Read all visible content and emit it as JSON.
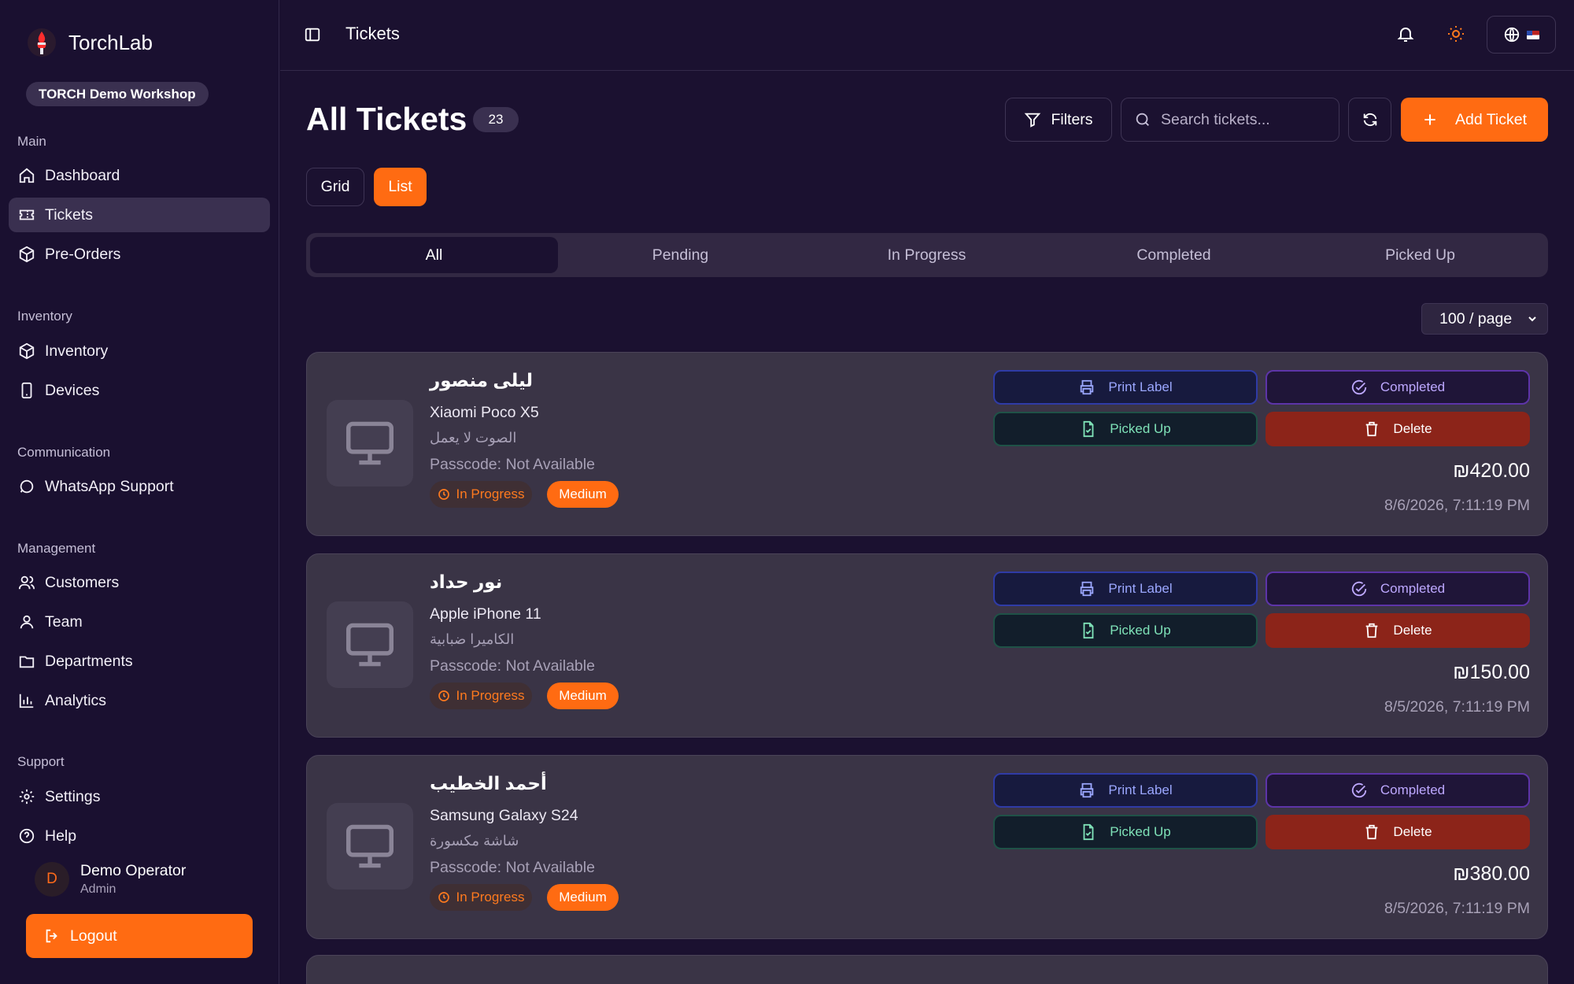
{
  "app": {
    "name": "TorchLab",
    "workspace": "TORCH Demo Workshop"
  },
  "sidebar": {
    "sections": [
      {
        "title": "Main",
        "items": [
          "Dashboard",
          "Tickets",
          "Pre-Orders"
        ]
      },
      {
        "title": "Inventory",
        "items": [
          "Inventory",
          "Devices"
        ]
      },
      {
        "title": "Communication",
        "items": [
          "WhatsApp Support"
        ]
      },
      {
        "title": "Management",
        "items": [
          "Customers",
          "Team",
          "Departments",
          "Analytics"
        ]
      },
      {
        "title": "Support",
        "items": [
          "Settings",
          "Help"
        ]
      }
    ],
    "active_item": "Tickets",
    "icons": [
      "home-icon",
      "ticket-icon",
      "package-icon",
      "package-icon",
      "smartphone-icon",
      "chat-icon",
      "users-icon",
      "user-icon",
      "folder-icon",
      "bar-chart-icon",
      "gear-icon",
      "help-icon"
    ]
  },
  "user": {
    "initial": "D",
    "name": "Demo Operator",
    "role": "Admin"
  },
  "logout_label": "Logout",
  "header": {
    "breadcrumb": "Tickets"
  },
  "page": {
    "title": "All Tickets",
    "count": "23",
    "filters_label": "Filters",
    "search_placeholder": "Search tickets...",
    "add_label": "Add Ticket",
    "views": {
      "grid": "Grid",
      "list": "List",
      "active": "List"
    },
    "tabs": [
      "All",
      "Pending",
      "In Progress",
      "Completed",
      "Picked Up"
    ],
    "active_tab": "All",
    "per_page": "100 / page"
  },
  "actions": {
    "print": "Print Label",
    "completed": "Completed",
    "picked": "Picked Up",
    "delete": "Delete"
  },
  "tickets": [
    {
      "customer": "ليلى منصور",
      "device": "Xiaomi Poco X5",
      "issue": "الصوت لا يعمل",
      "passcode": "Passcode: Not Available",
      "status": "In Progress",
      "priority": "Medium",
      "price": "₪420.00",
      "date": "8/6/2026, 7:11:19 PM"
    },
    {
      "customer": "نور حداد",
      "device": "Apple iPhone 11",
      "issue": "الكاميرا ضبابية",
      "passcode": "Passcode: Not Available",
      "status": "In Progress",
      "priority": "Medium",
      "price": "₪150.00",
      "date": "8/5/2026, 7:11:19 PM"
    },
    {
      "customer": "أحمد الخطيب",
      "device": "Samsung Galaxy S24",
      "issue": "شاشة مكسورة",
      "passcode": "Passcode: Not Available",
      "status": "In Progress",
      "priority": "Medium",
      "price": "₪380.00",
      "date": "8/5/2026, 7:11:19 PM"
    }
  ],
  "colors": {
    "accent": "#ff6b12",
    "background": "#1b1130",
    "delete": "#8c2419"
  }
}
